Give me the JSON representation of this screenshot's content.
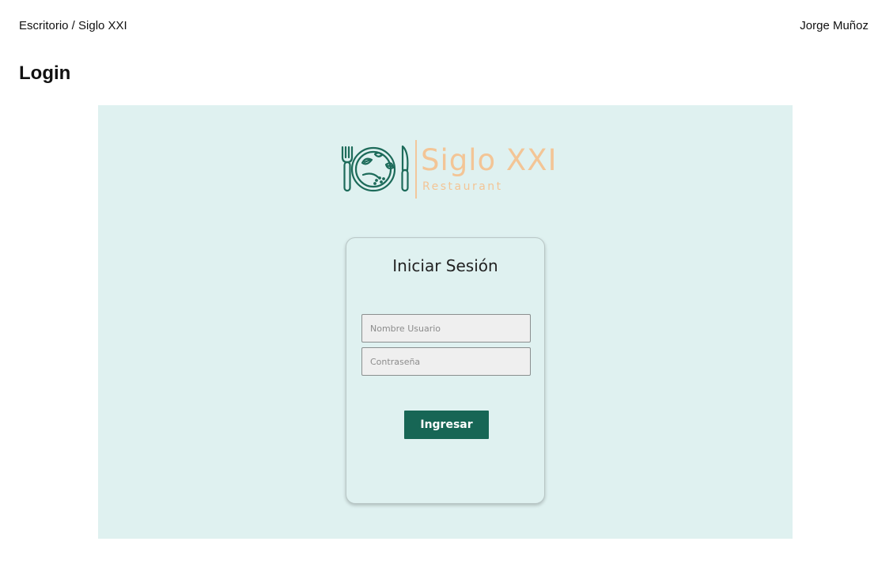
{
  "header": {
    "breadcrumb": "Escritorio / Siglo XXI",
    "user": "Jorge Muñoz"
  },
  "page": {
    "title": "Login"
  },
  "logo": {
    "brand": "Siglo XXI",
    "subtitle": "Restaurant",
    "icon": "plate-fork-knife-icon"
  },
  "login": {
    "title": "Iniciar Sesión",
    "username_placeholder": "Nombre Usuario",
    "username_value": "",
    "password_placeholder": "Contraseña",
    "password_value": "",
    "submit_label": "Ingresar"
  },
  "colors": {
    "frame_background": "#dff1f0",
    "primary": "#176655",
    "logo_accent": "#f3c596",
    "icon_stroke": "#1d6b5a"
  }
}
